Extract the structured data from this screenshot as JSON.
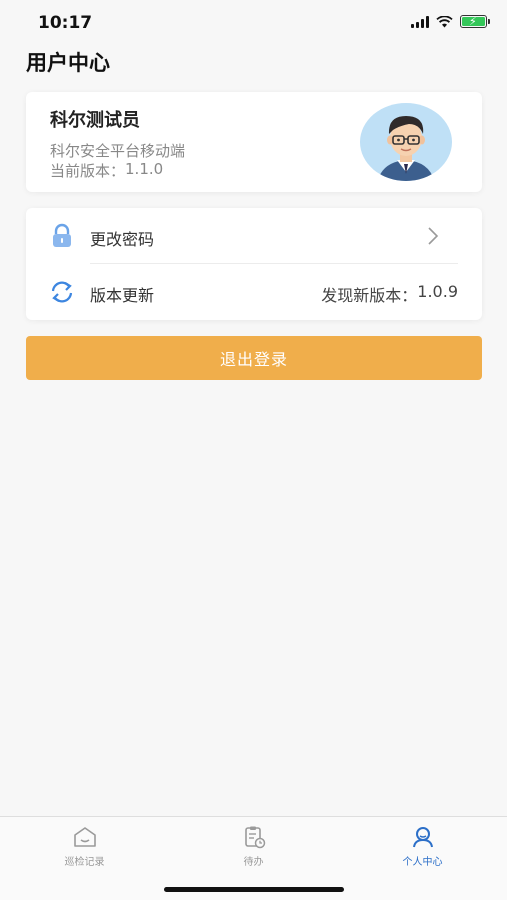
{
  "status_bar": {
    "time": "10:17",
    "icons": [
      "cellular-signal-icon",
      "wifi-icon",
      "battery-charging-icon"
    ]
  },
  "page": {
    "title": "用户中心"
  },
  "profile": {
    "name": "科尔测试员",
    "org": "科尔安全平台移动端",
    "version_label": "当前版本：",
    "version_value": "1.1.0",
    "avatar_icon": "user-avatar-illustration"
  },
  "settings": {
    "items": [
      {
        "label": "更改密码",
        "icon": "lock-icon",
        "trailing_icon": "chevron-right-icon"
      },
      {
        "label": "版本更新",
        "icon": "refresh-icon",
        "value_label": "发现新版本：",
        "value": "1.0.9"
      }
    ]
  },
  "logout": {
    "label": "退出登录",
    "color": "#f0ae4b"
  },
  "tab_bar": {
    "tabs": [
      {
        "label": "巡检记录",
        "icon": "inspection-record-icon",
        "active": false
      },
      {
        "label": "待办",
        "icon": "todo-clipboard-icon",
        "active": false
      },
      {
        "label": "个人中心",
        "icon": "person-icon",
        "active": true
      }
    ],
    "active_color": "#2c6fc8",
    "inactive_color": "#999999"
  }
}
